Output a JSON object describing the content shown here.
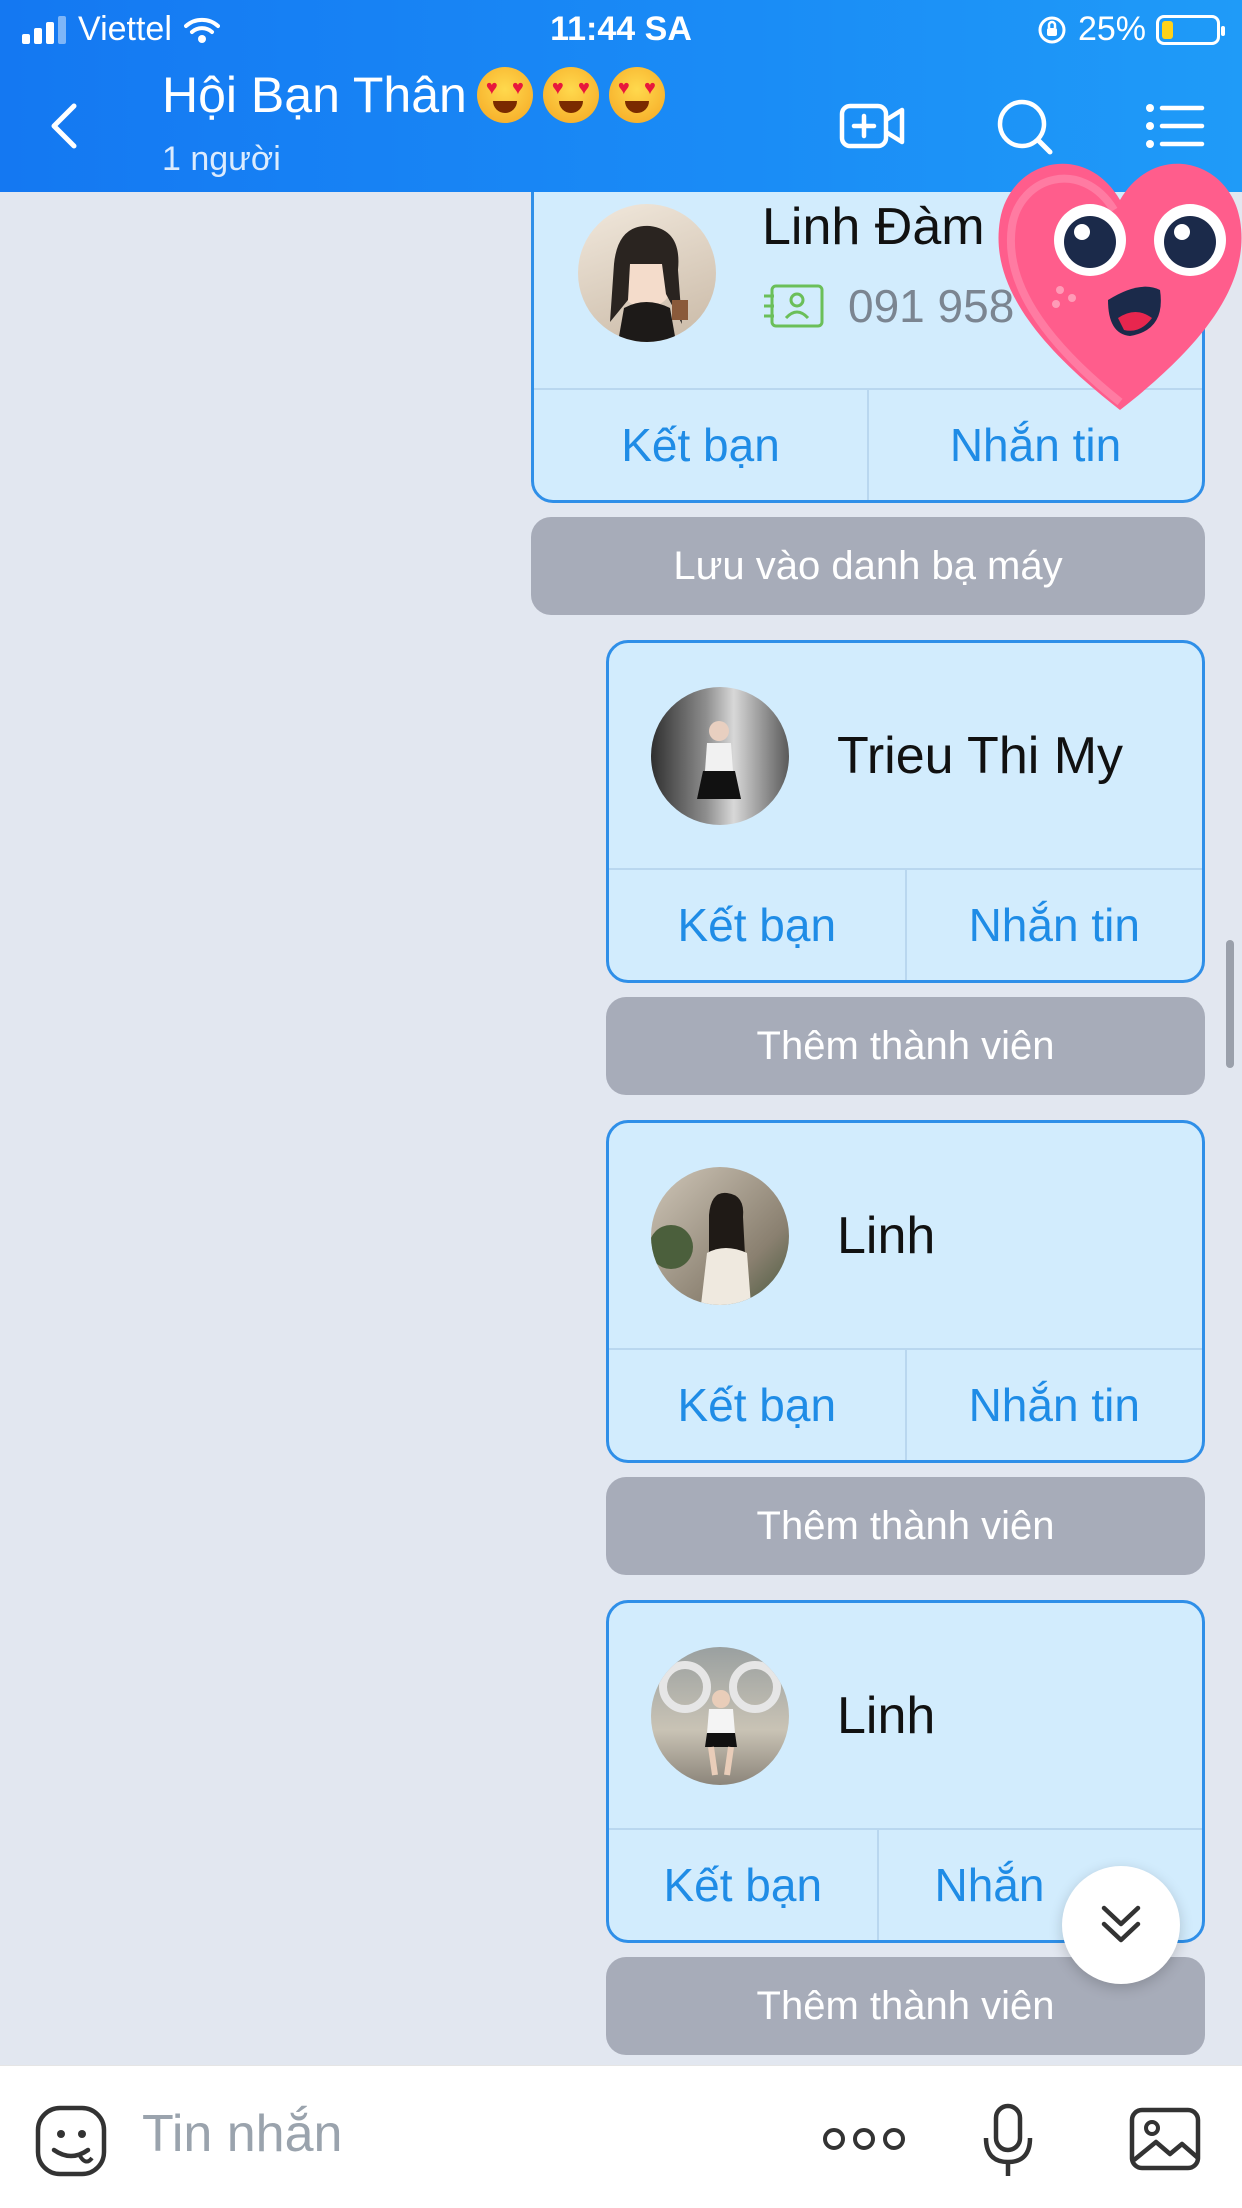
{
  "status_bar": {
    "carrier": "Viettel",
    "time": "11:44 SA",
    "battery": "25%"
  },
  "header": {
    "title": "Hội Bạn Thân",
    "subtitle": "1 người",
    "icons": [
      "back-icon",
      "add-video-call-icon",
      "search-icon",
      "menu-icon"
    ]
  },
  "cards": [
    {
      "name": "Linh Đàm",
      "phone": "091 958",
      "add_friend": "Kết bạn",
      "message": "Nhắn tin",
      "below_button": "Lưu vào danh bạ máy"
    },
    {
      "name": "Trieu Thi My",
      "add_friend": "Kết bạn",
      "message": "Nhắn tin",
      "below_button": "Thêm thành viên"
    },
    {
      "name": "Linh",
      "add_friend": "Kết bạn",
      "message": "Nhắn tin",
      "below_button": "Thêm thành viên"
    },
    {
      "name": "Linh",
      "add_friend": "Kết bạn",
      "message": "Nhắn",
      "below_button": "Thêm thành viên"
    }
  ],
  "composer": {
    "placeholder": "Tin nhắn",
    "icons": [
      "sticker-icon",
      "more-icon",
      "microphone-icon",
      "image-icon"
    ]
  },
  "colors": {
    "header": "#1a8cf6",
    "card_bg": "#d2ecfd",
    "card_border": "#2f8fe8",
    "link": "#1f8ce6",
    "gray_button": "#a7acb9",
    "chat_bg": "#e2e7f0"
  }
}
